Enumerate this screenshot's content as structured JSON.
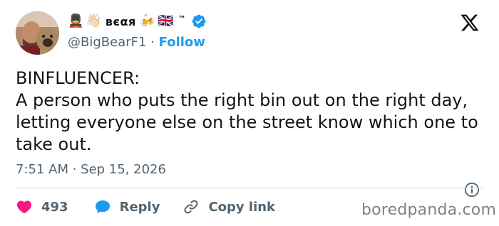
{
  "author": {
    "display_name": "вєαя",
    "emoji_left": [
      "💂",
      "👋🏻"
    ],
    "emoji_right": [
      "🍻",
      "🇬🇧"
    ],
    "trademark": "™",
    "handle": "@BigBearF1",
    "separator": "·",
    "follow_label": "Follow"
  },
  "tweet": {
    "text": "BINFLUENCER:\nA person who puts the right bin out on the right day, letting everyone else on the street know which one to take out.",
    "timestamp": "7:51 AM · Sep 15, 2026"
  },
  "actions": {
    "like_count": "493",
    "reply_label": "Reply",
    "copy_link_label": "Copy link"
  },
  "watermark": "boredpanda.com",
  "colors": {
    "like": "#f91880",
    "reply": "#1d9bf0",
    "verified": "#1d9bf0",
    "follow": "#1d9bf0",
    "secondary_text": "#536471"
  },
  "icons": [
    "x-logo-icon",
    "verified-badge-icon",
    "info-icon",
    "heart-icon",
    "reply-bubble-icon",
    "link-icon"
  ]
}
